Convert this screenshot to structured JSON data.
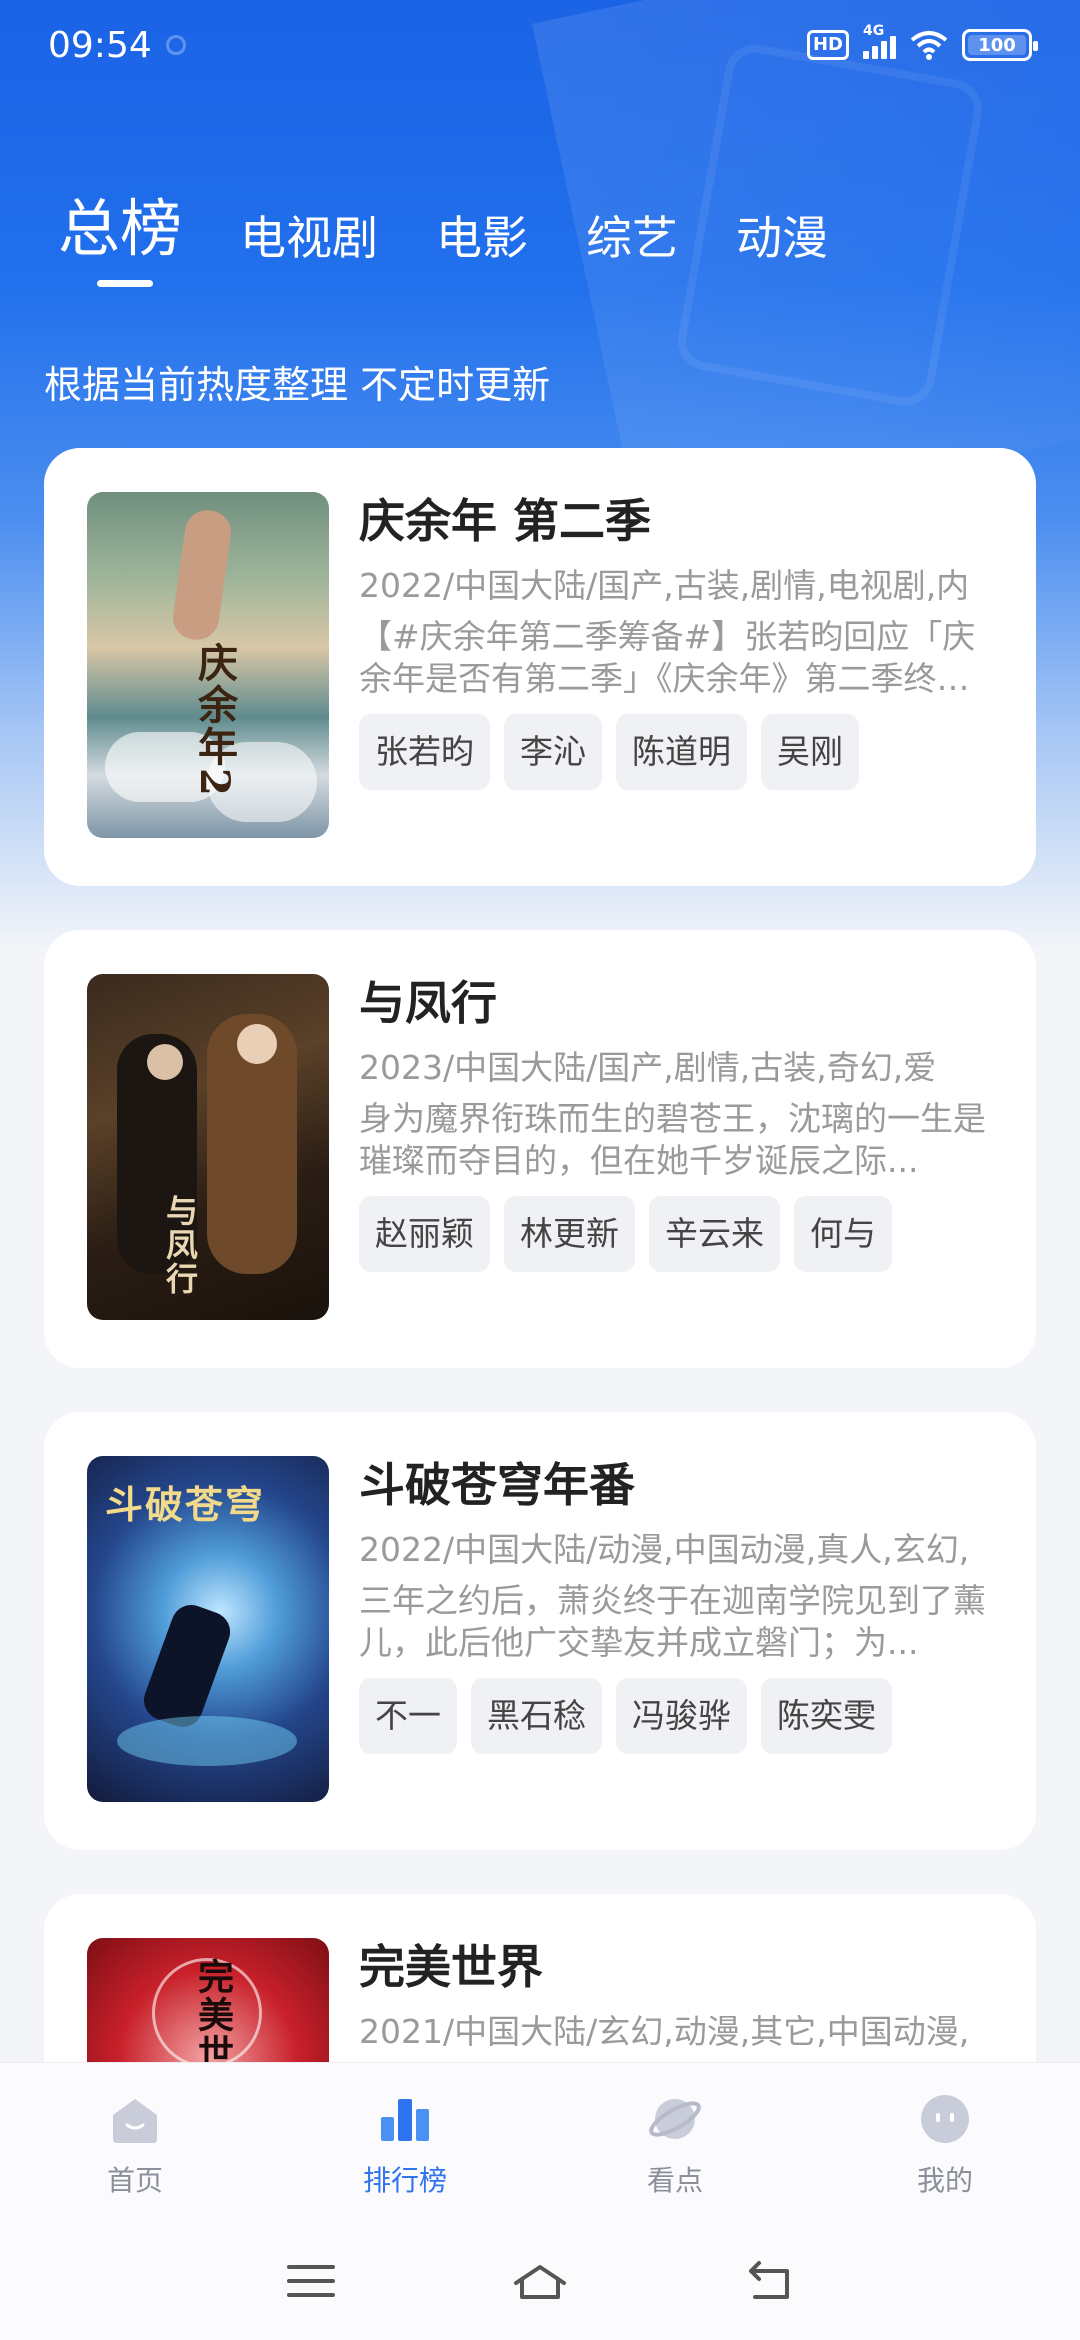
{
  "status": {
    "time": "09:54",
    "hd": "HD",
    "network": "4G",
    "battery": "100"
  },
  "tabs": [
    "总榜",
    "电视剧",
    "电影",
    "综艺",
    "动漫"
  ],
  "subtitle": "根据当前热度整理 不定时更新",
  "items": [
    {
      "title": "庆余年 第二季",
      "meta": "2022/中国大陆/国产,古装,剧情,电视剧,内",
      "desc": "【#庆余年第二季筹备#】张若昀回应「庆余年是否有第二季」《庆余年》第二季终于有消息了",
      "tags": [
        "张若昀",
        "李沁",
        "陈道明",
        "吴刚"
      ],
      "poster_text": "庆余年2"
    },
    {
      "title": "与凤行",
      "meta": "2023/中国大陆/国产,剧情,古装,奇幻,爱",
      "desc": "身为魔界衔珠而生的碧苍王，沈璃的一生是璀璨而夺目的，但在她千岁诞辰之际...",
      "tags": [
        "赵丽颖",
        "林更新",
        "辛云来",
        "何与"
      ],
      "poster_text": "与凤行"
    },
    {
      "title": "斗破苍穹年番",
      "meta": "2022/中国大陆/动漫,中国动漫,真人,玄幻,",
      "desc": "三年之约后，萧炎终于在迦南学院见到了薰儿，此后他广交挚友并成立磐门；为...",
      "tags": [
        "不一",
        "黑石稔",
        "冯骏骅",
        "陈奕雯"
      ],
      "poster_text": "斗破苍穹"
    },
    {
      "title": "完美世界",
      "meta": "2021/中国大陆/玄幻,动漫,其它,中国动漫,",
      "desc": "",
      "tags": [],
      "poster_text": "完美世界"
    }
  ],
  "nav": [
    {
      "label": "首页",
      "icon": "home-icon"
    },
    {
      "label": "排行榜",
      "icon": "ranking-icon"
    },
    {
      "label": "看点",
      "icon": "planet-icon"
    },
    {
      "label": "我的",
      "icon": "profile-icon"
    }
  ],
  "colors": {
    "accent": "#2f73ee",
    "hero": "#1b63e6"
  }
}
